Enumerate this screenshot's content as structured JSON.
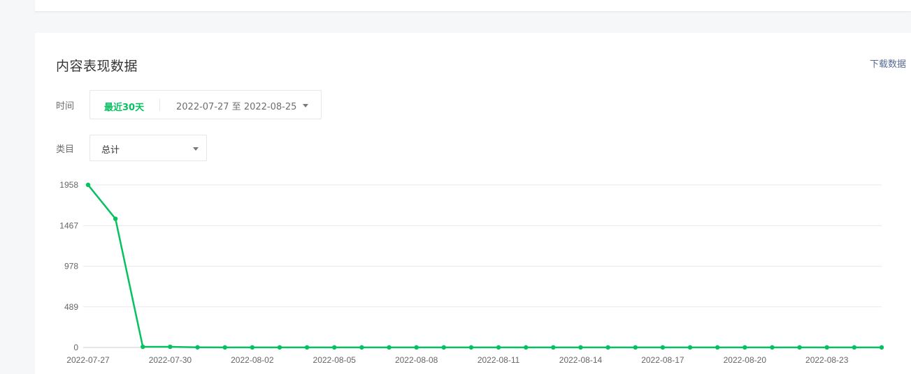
{
  "card": {
    "title": "内容表现数据",
    "download_label": "下载数据"
  },
  "filters": {
    "time_label": "时间",
    "quick_option": "最近30天",
    "date_range": "2022-07-27 至 2022-08-25",
    "category_label": "类目",
    "category_value": "总计"
  },
  "colors": {
    "accent": "#07c160",
    "link": "#576b95"
  },
  "chart_data": {
    "type": "line",
    "y_ticks": [
      "0",
      "489",
      "978",
      "1467",
      "1958"
    ],
    "ylim": [
      0,
      1958
    ],
    "x_tick_labels": [
      "2022-07-27",
      "2022-07-30",
      "2022-08-02",
      "2022-08-05",
      "2022-08-08",
      "2022-08-11",
      "2022-08-14",
      "2022-08-17",
      "2022-08-20",
      "2022-08-23"
    ],
    "x": [
      "2022-07-27",
      "2022-07-28",
      "2022-07-29",
      "2022-07-30",
      "2022-07-31",
      "2022-08-01",
      "2022-08-02",
      "2022-08-03",
      "2022-08-04",
      "2022-08-05",
      "2022-08-06",
      "2022-08-07",
      "2022-08-08",
      "2022-08-09",
      "2022-08-10",
      "2022-08-11",
      "2022-08-12",
      "2022-08-13",
      "2022-08-14",
      "2022-08-15",
      "2022-08-16",
      "2022-08-17",
      "2022-08-18",
      "2022-08-19",
      "2022-08-20",
      "2022-08-21",
      "2022-08-22",
      "2022-08-23",
      "2022-08-24",
      "2022-08-25"
    ],
    "series": [
      {
        "color": "#07c160",
        "values": [
          1958,
          1550,
          8,
          8,
          2,
          1,
          1,
          1,
          1,
          1,
          1,
          1,
          1,
          1,
          1,
          1,
          1,
          1,
          1,
          1,
          1,
          1,
          1,
          1,
          1,
          1,
          1,
          1,
          1,
          1
        ]
      }
    ],
    "grid": true
  }
}
